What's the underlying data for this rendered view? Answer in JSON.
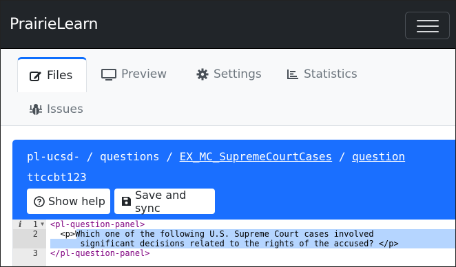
{
  "navbar": {
    "brand": "PrairieLearn"
  },
  "tabs": [
    {
      "label": "Files",
      "icon": "edit-icon",
      "active": true
    },
    {
      "label": "Preview",
      "icon": "monitor-icon",
      "active": false
    },
    {
      "label": "Settings",
      "icon": "gear-icon",
      "active": false
    },
    {
      "label": "Statistics",
      "icon": "chart-icon",
      "active": false
    },
    {
      "label": "Issues",
      "icon": "bug-icon",
      "active": false
    }
  ],
  "breadcrumb": {
    "course": "pl-ucsd-",
    "sep1": "/",
    "questions": "questions",
    "sep2": "/",
    "question_folder": "EX_MC_SupremeCourtCases",
    "sep3": "/",
    "tail": "question",
    "course_suffix": "ttccbt123"
  },
  "buttons": {
    "help": "Show help",
    "save": "Save and sync"
  },
  "editor": {
    "lines": [
      {
        "num": "1",
        "text": "<pl-question-panel>"
      },
      {
        "num": "2",
        "text": "  <p>Which one of the following U.S. Supreme Court cases involved"
      },
      {
        "num": "",
        "text": "      significant decisions related to the rights of the accused? </p>"
      },
      {
        "num": "3",
        "text": "</pl-question-panel>"
      }
    ],
    "info_marker": "i"
  },
  "colors": {
    "navbar_bg": "#212529",
    "accent": "#1a6fff",
    "active_tab_border": "#0d6efd",
    "selection": "#b5d5ff"
  }
}
